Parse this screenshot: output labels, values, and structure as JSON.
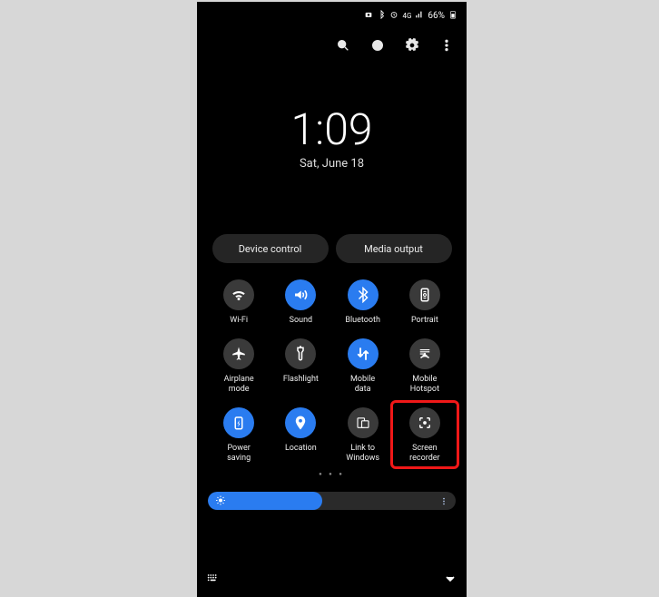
{
  "status": {
    "battery": "66%",
    "network": "4G"
  },
  "clock": {
    "time": "1:09",
    "date": "Sat, June 18"
  },
  "pills": [
    {
      "label": "Device control"
    },
    {
      "label": "Media output"
    }
  ],
  "tiles": [
    {
      "label": "Wi-Fi",
      "active": false,
      "icon": "wifi"
    },
    {
      "label": "Sound",
      "active": true,
      "icon": "sound"
    },
    {
      "label": "Bluetooth",
      "active": true,
      "icon": "bluetooth"
    },
    {
      "label": "Portrait",
      "active": false,
      "icon": "portrait"
    },
    {
      "label": "Airplane\nmode",
      "active": false,
      "icon": "airplane"
    },
    {
      "label": "Flashlight",
      "active": false,
      "icon": "flashlight"
    },
    {
      "label": "Mobile\ndata",
      "active": true,
      "icon": "mobiledata"
    },
    {
      "label": "Mobile\nHotspot",
      "active": false,
      "icon": "hotspot"
    },
    {
      "label": "Power\nsaving",
      "active": true,
      "icon": "power"
    },
    {
      "label": "Location",
      "active": true,
      "icon": "location"
    },
    {
      "label": "Link to\nWindows",
      "active": false,
      "icon": "link"
    },
    {
      "label": "Screen\nrecorder",
      "active": false,
      "icon": "record",
      "highlight": true
    }
  ],
  "brightness": {
    "percent": 46
  }
}
